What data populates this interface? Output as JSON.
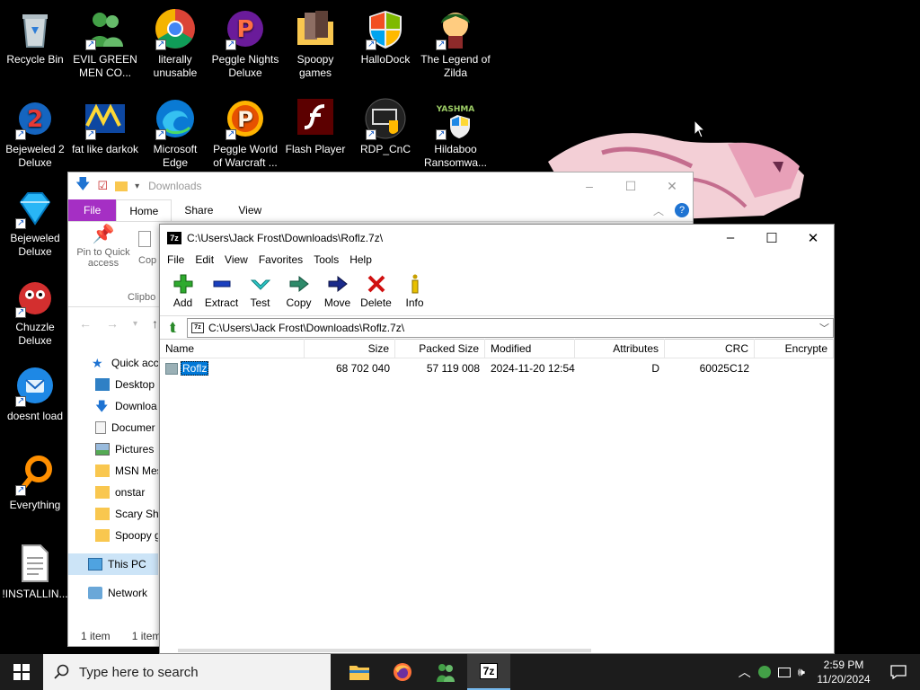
{
  "desktop": {
    "icons": [
      {
        "label": "Recycle Bin"
      },
      {
        "label": "EVIL GREEN MEN CO..."
      },
      {
        "label": "literally unusable"
      },
      {
        "label": "Peggle Nights Deluxe"
      },
      {
        "label": "Spoopy games"
      },
      {
        "label": "HalloDock"
      },
      {
        "label": "The Legend of Zilda"
      },
      {
        "label": "Bejeweled 2 Deluxe"
      },
      {
        "label": "fat like darkok"
      },
      {
        "label": "Microsoft Edge"
      },
      {
        "label": "Peggle World of Warcraft ..."
      },
      {
        "label": "Flash Player"
      },
      {
        "label": "RDP_CnC"
      },
      {
        "label": "Hildaboo Ransomwa..."
      },
      {
        "label": "Bejeweled Deluxe"
      },
      {
        "label": "Chuzzle Deluxe"
      },
      {
        "label": "doesnt load"
      },
      {
        "label": "Everything"
      },
      {
        "label": "!INSTALLIN..."
      }
    ],
    "hildaboo_logo_text": "YASHMA"
  },
  "explorer": {
    "title": "Downloads",
    "tabs": [
      "File",
      "Home",
      "Share",
      "View"
    ],
    "ribbon": {
      "pin_label": "Pin to Quick access",
      "copy_label": "Cop",
      "group_label": "Clipbo"
    },
    "nav": [
      {
        "label": "Quick acce",
        "icon": "star-icon"
      },
      {
        "label": "Desktop",
        "icon": "desktop-icon"
      },
      {
        "label": "Downloa",
        "icon": "download-icon"
      },
      {
        "label": "Documer",
        "icon": "document-icon"
      },
      {
        "label": "Pictures",
        "icon": "pictures-icon"
      },
      {
        "label": "MSN Mes",
        "icon": "folder-icon"
      },
      {
        "label": "onstar",
        "icon": "folder-icon"
      },
      {
        "label": "Scary Shi",
        "icon": "folder-icon"
      },
      {
        "label": "Spoopy g",
        "icon": "folder-icon"
      },
      {
        "label": "This PC",
        "icon": "pc-icon"
      },
      {
        "label": "Network",
        "icon": "network-icon"
      }
    ],
    "status_left": "1 item",
    "status_right": "1 item"
  },
  "sevenzip": {
    "title": "C:\\Users\\Jack Frost\\Downloads\\Roflz.7z\\",
    "app_icon_text": "7z",
    "menu": [
      "File",
      "Edit",
      "View",
      "Favorites",
      "Tools",
      "Help"
    ],
    "toolbar": [
      "Add",
      "Extract",
      "Test",
      "Copy",
      "Move",
      "Delete",
      "Info"
    ],
    "path": "C:\\Users\\Jack Frost\\Downloads\\Roflz.7z\\",
    "columns": [
      "Name",
      "Size",
      "Packed Size",
      "Modified",
      "Attributes",
      "CRC",
      "Encrypte"
    ],
    "rows": [
      {
        "name": "Roflz",
        "size": "68 702 040",
        "packed": "57 119 008",
        "modified": "2024-11-20 12:54",
        "attributes": "D",
        "crc": "60025C12",
        "encrypted": ""
      }
    ]
  },
  "taskbar": {
    "search_placeholder": "Type here to search",
    "time": "2:59 PM",
    "date": "11/20/2024",
    "active_app_text": "7z"
  },
  "colors": {
    "file_tab": "#a52fc4",
    "selection": "#0078d7",
    "taskbar": "#1c1c1c"
  }
}
